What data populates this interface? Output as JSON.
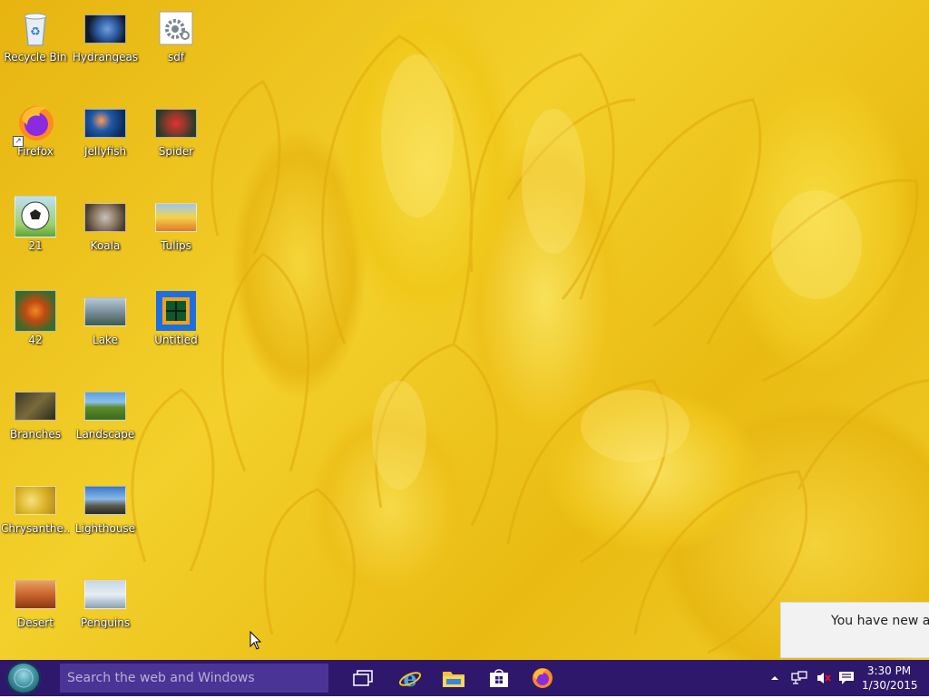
{
  "desktop": {
    "icons": [
      {
        "label": "Recycle Bin",
        "icon": "recycle-bin-icon"
      },
      {
        "label": "Hydrangeas",
        "icon": "image-file-icon"
      },
      {
        "label": "sdf",
        "icon": "settings-file-icon"
      },
      {
        "label": "Firefox",
        "icon": "firefox-icon"
      },
      {
        "label": "Jellyfish",
        "icon": "image-file-icon"
      },
      {
        "label": "Spider",
        "icon": "image-file-icon"
      },
      {
        "label": "21",
        "icon": "soccer-ball-icon"
      },
      {
        "label": "Koala",
        "icon": "image-file-icon"
      },
      {
        "label": "Tulips",
        "icon": "image-file-icon"
      },
      {
        "label": "42",
        "icon": "butterfly-image-icon"
      },
      {
        "label": "Lake",
        "icon": "image-file-icon"
      },
      {
        "label": "Untitled",
        "icon": "window-app-icon"
      },
      {
        "label": "Branches",
        "icon": "image-file-icon"
      },
      {
        "label": "Landscape",
        "icon": "image-file-icon"
      },
      {
        "label": "Chrysanthe...",
        "icon": "image-file-icon"
      },
      {
        "label": "Lighthouse",
        "icon": "image-file-icon"
      },
      {
        "label": "Desert",
        "icon": "image-file-icon"
      },
      {
        "label": "Penguins",
        "icon": "image-file-icon"
      }
    ]
  },
  "notification": {
    "text": "You have new ap"
  },
  "taskbar": {
    "search_placeholder": "Search the web and Windows",
    "pinned": [
      "task-view-icon",
      "internet-explorer-icon",
      "file-explorer-icon",
      "store-icon",
      "firefox-icon"
    ],
    "tray_icons": [
      "show-hidden-icons-chevron",
      "network-icon",
      "volume-muted-icon",
      "action-center-icon"
    ],
    "time": "3:30 PM",
    "date": "1/30/2015"
  },
  "colors": {
    "taskbar": "#2e186b",
    "search_box": "#4a3496",
    "wallpaper_base": "#f0c81a"
  }
}
